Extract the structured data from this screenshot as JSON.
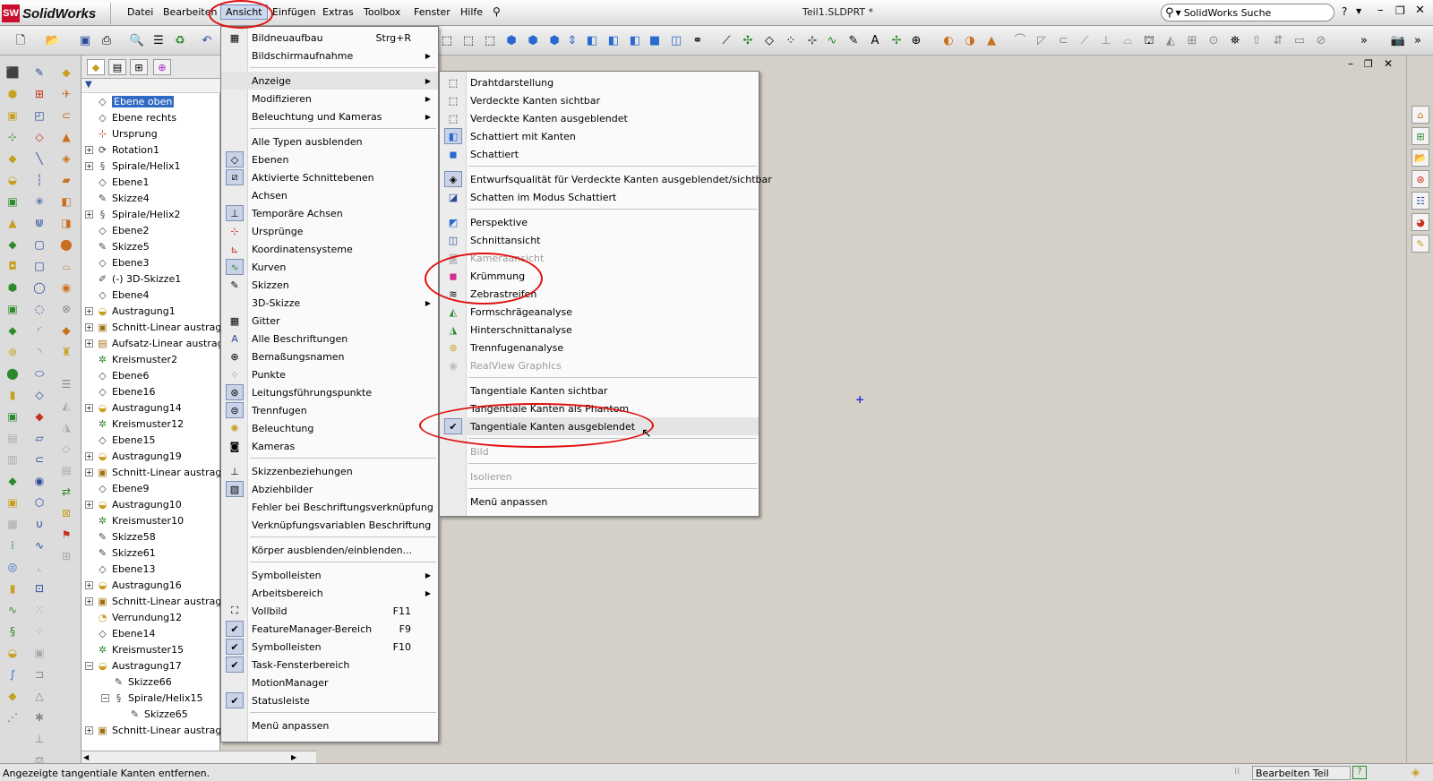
{
  "app": {
    "logo_text": "SolidWorks",
    "logo_mark": "SW",
    "document_title": "Teil1.SLDPRT *"
  },
  "menubar": [
    "Datei",
    "Bearbeiten",
    "Ansicht",
    "Einfügen",
    "Extras",
    "Toolbox",
    "Fenster",
    "Hilfe"
  ],
  "search": {
    "placeholder": "SolidWorks Suche"
  },
  "feature_tree": [
    {
      "label": "Ebene oben",
      "icon": "plane-icon",
      "selected": true
    },
    {
      "label": "Ebene rechts",
      "icon": "plane-icon"
    },
    {
      "label": "Ursprung",
      "icon": "origin-icon"
    },
    {
      "label": "Rotation1",
      "icon": "revolve-icon",
      "expand": "+"
    },
    {
      "label": "Spirale/Helix1",
      "icon": "helix-icon",
      "expand": "+"
    },
    {
      "label": "Ebene1",
      "icon": "plane-icon"
    },
    {
      "label": "Skizze4",
      "icon": "sketch-icon"
    },
    {
      "label": "Spirale/Helix2",
      "icon": "helix-icon",
      "expand": "+"
    },
    {
      "label": "Ebene2",
      "icon": "plane-icon"
    },
    {
      "label": "Skizze5",
      "icon": "sketch-icon"
    },
    {
      "label": "Ebene3",
      "icon": "plane-icon"
    },
    {
      "label": "(-) 3D-Skizze1",
      "icon": "3d-sketch-icon"
    },
    {
      "label": "Ebene4",
      "icon": "plane-icon"
    },
    {
      "label": "Austragung1",
      "icon": "sweep-icon",
      "expand": "+"
    },
    {
      "label": "Schnitt-Linear austragen",
      "icon": "cut-extrude-icon",
      "expand": "+"
    },
    {
      "label": "Aufsatz-Linear austragen",
      "icon": "boss-extrude-icon",
      "expand": "+"
    },
    {
      "label": "Kreismuster2",
      "icon": "circular-pattern-icon"
    },
    {
      "label": "Ebene6",
      "icon": "plane-icon"
    },
    {
      "label": "Ebene16",
      "icon": "plane-icon"
    },
    {
      "label": "Austragung14",
      "icon": "sweep-icon",
      "expand": "+"
    },
    {
      "label": "Kreismuster12",
      "icon": "circular-pattern-icon"
    },
    {
      "label": "Ebene15",
      "icon": "plane-icon"
    },
    {
      "label": "Austragung19",
      "icon": "sweep-icon",
      "expand": "+"
    },
    {
      "label": "Schnitt-Linear austragen",
      "icon": "cut-extrude-icon",
      "expand": "+"
    },
    {
      "label": "Ebene9",
      "icon": "plane-icon"
    },
    {
      "label": "Austragung10",
      "icon": "sweep-icon",
      "expand": "+"
    },
    {
      "label": "Kreismuster10",
      "icon": "circular-pattern-icon"
    },
    {
      "label": "Skizze58",
      "icon": "sketch-icon"
    },
    {
      "label": "Skizze61",
      "icon": "sketch-icon"
    },
    {
      "label": "Ebene13",
      "icon": "plane-icon"
    },
    {
      "label": "Austragung16",
      "icon": "sweep-icon",
      "expand": "+"
    },
    {
      "label": "Schnitt-Linear austragen",
      "icon": "cut-extrude-icon",
      "expand": "+"
    },
    {
      "label": "Verrundung12",
      "icon": "fillet-icon"
    },
    {
      "label": "Ebene14",
      "icon": "plane-icon"
    },
    {
      "label": "Kreismuster15",
      "icon": "circular-pattern-icon"
    },
    {
      "label": "Austragung17",
      "icon": "sweep-icon",
      "expand": "−"
    },
    {
      "label": "Skizze66",
      "icon": "sketch-icon",
      "level": 1
    },
    {
      "label": "Spirale/Helix15",
      "icon": "helix-icon",
      "level": 1,
      "expand": "−"
    },
    {
      "label": "Skizze65",
      "icon": "sketch-icon",
      "level": 2
    },
    {
      "label": "Schnitt-Linear austragen",
      "icon": "cut-extrude-icon",
      "expand": "+"
    }
  ],
  "ansicht_menu": [
    {
      "label": "Bildneuaufbau",
      "shortcut": "Strg+R",
      "icon": "redraw-icon"
    },
    {
      "label": "Bildschirmaufnahme",
      "submenu": true
    },
    {
      "sep": true
    },
    {
      "label": "Anzeige",
      "submenu": true,
      "highlight": true
    },
    {
      "label": "Modifizieren",
      "submenu": true
    },
    {
      "label": "Beleuchtung und Kameras",
      "submenu": true
    },
    {
      "sep": true
    },
    {
      "label": "Alle Typen ausblenden"
    },
    {
      "label": "Ebenen",
      "icon": "plane-icon",
      "framed": true
    },
    {
      "label": "Aktivierte Schnittebenen",
      "icon": "section-plane-icon",
      "framed": true
    },
    {
      "label": "Achsen"
    },
    {
      "label": "Temporäre Achsen",
      "icon": "temp-axis-icon",
      "framed": true
    },
    {
      "label": "Ursprünge",
      "icon": "origin-icon"
    },
    {
      "label": "Koordinatensysteme",
      "icon": "coordinate-system-icon"
    },
    {
      "label": "Kurven",
      "icon": "curve-icon",
      "framed": true
    },
    {
      "label": "Skizzen",
      "icon": "sketch-icon"
    },
    {
      "label": "3D-Skizze",
      "submenu": true
    },
    {
      "label": "Gitter",
      "icon": "grid-icon"
    },
    {
      "label": "Alle Beschriftungen",
      "icon": "annotation-icon"
    },
    {
      "label": "Bemaßungsnamen",
      "icon": "dimension-name-icon"
    },
    {
      "label": "Punkte",
      "icon": "points-icon"
    },
    {
      "label": "Leitungsführungspunkte",
      "icon": "routing-points-icon",
      "framed": true
    },
    {
      "label": "Trennfugen",
      "icon": "parting-line-icon",
      "framed": true
    },
    {
      "label": "Beleuchtung",
      "icon": "light-bulb-icon"
    },
    {
      "label": "Kameras",
      "icon": "camera-icon"
    },
    {
      "sep": true
    },
    {
      "label": "Skizzenbeziehungen",
      "icon": "sketch-relations-icon"
    },
    {
      "label": "Abziehbilder",
      "icon": "decal-icon",
      "framed": true
    },
    {
      "label": "Fehler bei Beschriftungsverknüpfung"
    },
    {
      "label": "Verknüpfungsvariablen Beschriftung"
    },
    {
      "sep": true
    },
    {
      "label": "Körper ausblenden/einblenden..."
    },
    {
      "sep": true
    },
    {
      "label": "Symbolleisten",
      "submenu": true
    },
    {
      "label": "Arbeitsbereich",
      "submenu": true
    },
    {
      "label": "Vollbild",
      "shortcut": "F11",
      "icon": "fullscreen-icon"
    },
    {
      "label": "FeatureManager-Bereich",
      "shortcut": "F9",
      "icon": "check-icon",
      "framed": true
    },
    {
      "label": "Symbolleisten",
      "shortcut": "F10",
      "icon": "check-icon",
      "framed": true
    },
    {
      "label": "Task-Fensterbereich",
      "icon": "check-icon",
      "framed": true
    },
    {
      "label": "MotionManager"
    },
    {
      "label": "Statusleiste",
      "icon": "check-icon",
      "framed": true
    },
    {
      "sep": true
    },
    {
      "label": "Menü anpassen"
    }
  ],
  "anzeige_menu": [
    {
      "label": "Drahtdarstellung",
      "icon": "wireframe-icon"
    },
    {
      "label": "Verdeckte Kanten sichtbar",
      "icon": "hidden-lines-visible-icon"
    },
    {
      "label": "Verdeckte Kanten ausgeblendet",
      "icon": "hidden-lines-removed-icon"
    },
    {
      "label": "Schattiert mit Kanten",
      "icon": "shaded-edges-icon",
      "framed": true
    },
    {
      "label": "Schattiert",
      "icon": "shaded-icon"
    },
    {
      "sep": true
    },
    {
      "label": "Entwurfsqualität für Verdeckte Kanten ausgeblendet/sichtbar",
      "icon": "draft-quality-icon",
      "framed": true
    },
    {
      "label": "Schatten im Modus Schattiert",
      "icon": "shadows-icon"
    },
    {
      "sep": true
    },
    {
      "label": "Perspektive",
      "icon": "perspective-icon"
    },
    {
      "label": "Schnittansicht",
      "icon": "section-view-icon"
    },
    {
      "label": "Kameraansicht",
      "icon": "camera-view-icon",
      "disabled": true
    },
    {
      "label": "Krümmung",
      "icon": "curvature-icon"
    },
    {
      "label": "Zebrastreifen",
      "icon": "zebra-stripes-icon"
    },
    {
      "label": "Formschrägeanalyse",
      "icon": "draft-analysis-icon"
    },
    {
      "label": "Hinterschnittanalyse",
      "icon": "undercut-analysis-icon"
    },
    {
      "label": "Trennfugenanalyse",
      "icon": "parting-line-analysis-icon"
    },
    {
      "label": "RealView Graphics",
      "icon": "realview-icon",
      "disabled": true
    },
    {
      "sep": true
    },
    {
      "label": "Tangentiale Kanten sichtbar"
    },
    {
      "label": "Tangentiale Kanten als Phantom"
    },
    {
      "label": "Tangentiale Kanten ausgeblendet",
      "icon": "check-icon",
      "framed": true,
      "highlight": true
    },
    {
      "sep": true
    },
    {
      "label": "Bild",
      "disabled": true
    },
    {
      "sep": true
    },
    {
      "label": "Isolieren",
      "disabled": true
    },
    {
      "sep": true
    },
    {
      "label": "Menü anpassen"
    }
  ],
  "statusbar": {
    "message": "Angezeigte tangentiale Kanten entfernen.",
    "mode": "Bearbeiten Teil"
  },
  "colors": {
    "annotation_circle": "#e01010",
    "selection": "#316ac5"
  }
}
